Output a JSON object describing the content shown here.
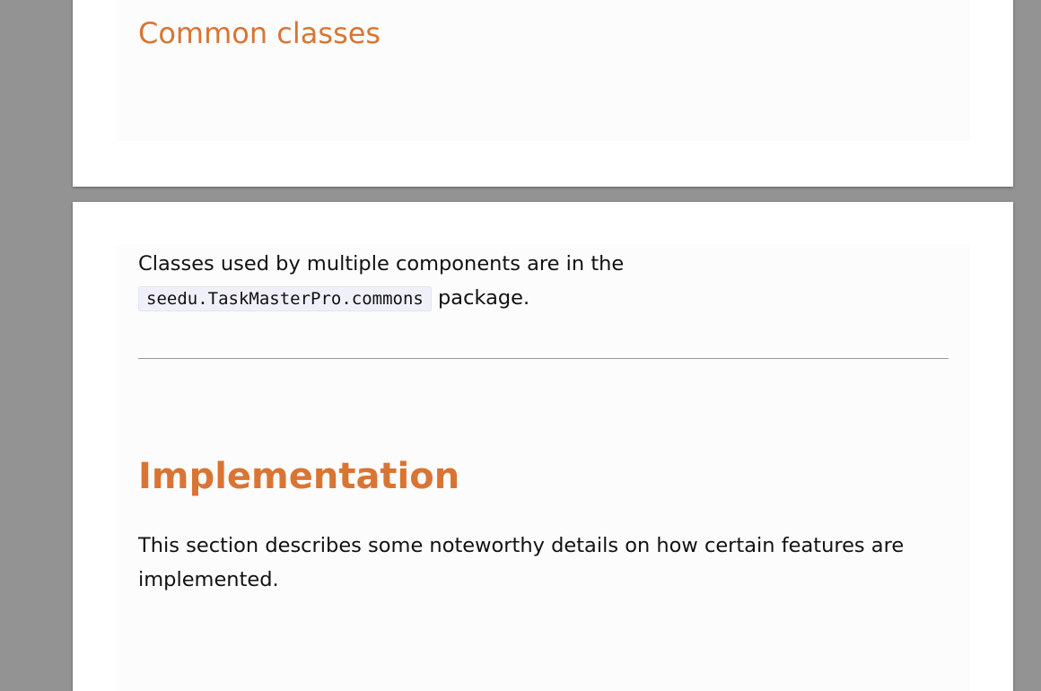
{
  "sections": {
    "common_classes": {
      "heading": "Common classes",
      "paragraph_line1": "Classes used by multiple components are in the",
      "code": "seedu.TaskMasterPro.commons",
      "paragraph_tail": "package."
    },
    "implementation": {
      "heading": "Implementation",
      "paragraph_line1": "This section describes some noteworthy details on how certain features are",
      "paragraph_line2": "implemented."
    }
  },
  "colors": {
    "heading": "#d97534",
    "viewer_background": "#939393",
    "page": "#ffffff",
    "content_background": "#fcfcfc",
    "code_background": "#f0f0fa"
  }
}
